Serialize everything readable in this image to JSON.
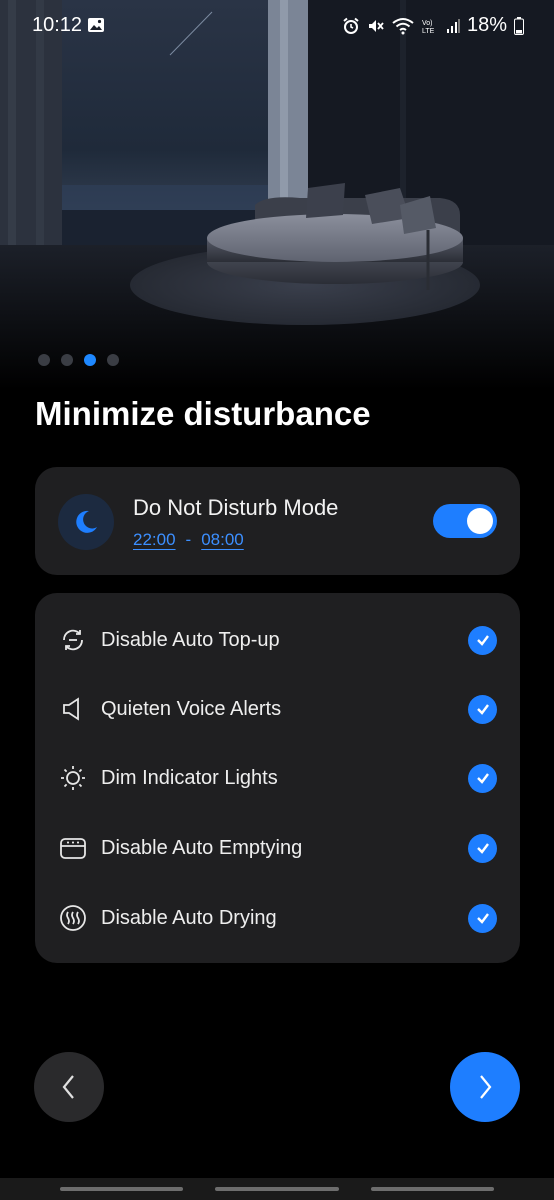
{
  "status_bar": {
    "time": "10:12",
    "battery": "18%",
    "icons": [
      "gallery-icon",
      "alarm-icon",
      "mute-icon",
      "wifi-icon",
      "volte-icon",
      "signal-icon",
      "battery-icon"
    ]
  },
  "carousel": {
    "pages": 4,
    "active_index": 2
  },
  "page": {
    "title": "Minimize disturbance"
  },
  "dnd": {
    "title": "Do Not Disturb Mode",
    "start_time": "22:00",
    "separator": "-",
    "end_time": "08:00",
    "enabled": true,
    "icon": "moon-icon"
  },
  "options": [
    {
      "label": "Disable Auto Top-up",
      "icon": "auto-topup-icon",
      "checked": true
    },
    {
      "label": "Quieten Voice Alerts",
      "icon": "speaker-icon",
      "checked": true
    },
    {
      "label": "Dim Indicator Lights",
      "icon": "sun-icon",
      "checked": true
    },
    {
      "label": "Disable Auto Emptying",
      "icon": "dustbin-icon",
      "checked": true
    },
    {
      "label": "Disable Auto Drying",
      "icon": "heat-icon",
      "checked": true
    }
  ],
  "colors": {
    "accent": "#1e7eff",
    "card": "#1f1f21",
    "background": "#000000"
  }
}
